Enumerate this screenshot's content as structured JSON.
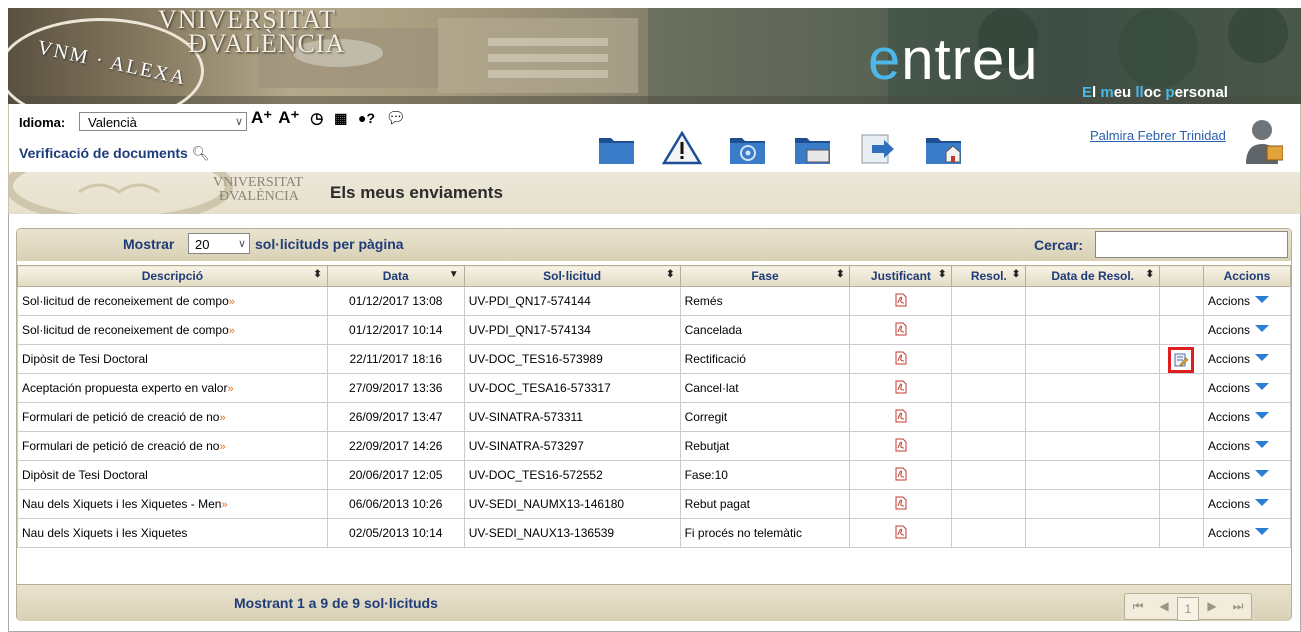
{
  "banner": {
    "uv_line1": "VNIVERSITAT",
    "uv_line2": "ÐVALÈNCIA",
    "seal_text": "VNM · ALEXA",
    "brand_e": "e",
    "brand_rest": "ntreu",
    "slogan": [
      {
        "c": "E",
        "r": "l "
      },
      {
        "c": "m",
        "r": "eu "
      },
      {
        "c": "ll",
        "r": "oc "
      },
      {
        "c": "p",
        "r": "ersonal"
      }
    ]
  },
  "toolbar": {
    "idioma_label": "Idioma:",
    "language": "Valencià",
    "font_up": "A⁺",
    "font_down": "A⁺",
    "verificacio": "Verificació de documents",
    "user_name": "Palmira  Febrer Trinidad"
  },
  "crumb": {
    "logo_line1": "VNIVERSITAT",
    "logo_line2": "ÐVALÈNCIA",
    "title": "Els meus enviaments"
  },
  "table": {
    "mostrar_label": "Mostrar",
    "page_size": "20",
    "per_page_label": "sol·licituds per pàgina",
    "search_label": "Cercar:",
    "columns": [
      "Descripció",
      "Data",
      "Sol·licitud",
      "Fase",
      "Justificant",
      "Resol.",
      "Data de Resol.",
      "",
      "Accions"
    ],
    "rows": [
      {
        "desc": "Sol·licitud de reconeixement de compo",
        "more": "»",
        "date": "01/12/2017 13:08",
        "sol": "UV-PDI_QN17-574144",
        "fase": "Remés",
        "edit": false,
        "accions": "Accions"
      },
      {
        "desc": "Sol·licitud de reconeixement de compo",
        "more": "»",
        "date": "01/12/2017 10:14",
        "sol": "UV-PDI_QN17-574134",
        "fase": "Cancelada",
        "edit": false,
        "accions": "Accions"
      },
      {
        "desc": "Dipòsit de Tesi Doctoral",
        "more": "",
        "date": "22/11/2017 18:16",
        "sol": "UV-DOC_TES16-573989",
        "fase": "Rectificació",
        "edit": true,
        "accions": "Accions"
      },
      {
        "desc": "Aceptación propuesta experto en valor",
        "more": "»",
        "date": "27/09/2017 13:36",
        "sol": "UV-DOC_TESA16-573317",
        "fase": "Cancel·lat",
        "edit": false,
        "accions": "Accions"
      },
      {
        "desc": "Formulari de petició de creació de no",
        "more": "»",
        "date": "26/09/2017 13:47",
        "sol": "UV-SINATRA-573311",
        "fase": "Corregit",
        "edit": false,
        "accions": "Accions"
      },
      {
        "desc": "Formulari de petició de creació de no",
        "more": "»",
        "date": "22/09/2017 14:26",
        "sol": "UV-SINATRA-573297",
        "fase": "Rebutjat",
        "edit": false,
        "accions": "Accions"
      },
      {
        "desc": "Dipòsit de Tesi Doctoral",
        "more": "",
        "date": "20/06/2017 12:05",
        "sol": "UV-DOC_TES16-572552",
        "fase": "Fase:10",
        "edit": false,
        "accions": "Accions"
      },
      {
        "desc": "Nau dels Xiquets i les Xiquetes - Men",
        "more": "»",
        "date": "06/06/2013 10:26",
        "sol": "UV-SEDI_NAUMX13-146180",
        "fase": "Rebut pagat",
        "edit": false,
        "accions": "Accions"
      },
      {
        "desc": "Nau dels Xiquets i les Xiquetes",
        "more": "",
        "date": "02/05/2013 10:14",
        "sol": "UV-SEDI_NAUX13-136539",
        "fase": "Fi procés no telemàtic",
        "edit": false,
        "accions": "Accions"
      }
    ],
    "footer": {
      "pre": "Mostrant ",
      "from": "1",
      "mid": " a ",
      "to": "9",
      "mid2": " de ",
      "total": "9",
      "post": " sol·licituds"
    },
    "pager": {
      "first": "⏮",
      "prev": "◀",
      "current": "1",
      "next": "▶",
      "last": "⏭"
    }
  },
  "colors": {
    "accent": "#1f3b79",
    "link": "#2a60b0",
    "brand_blue": "#4cb7e8",
    "highlight": "#e21d1d",
    "accions_arrow": "#2a7fd4"
  }
}
